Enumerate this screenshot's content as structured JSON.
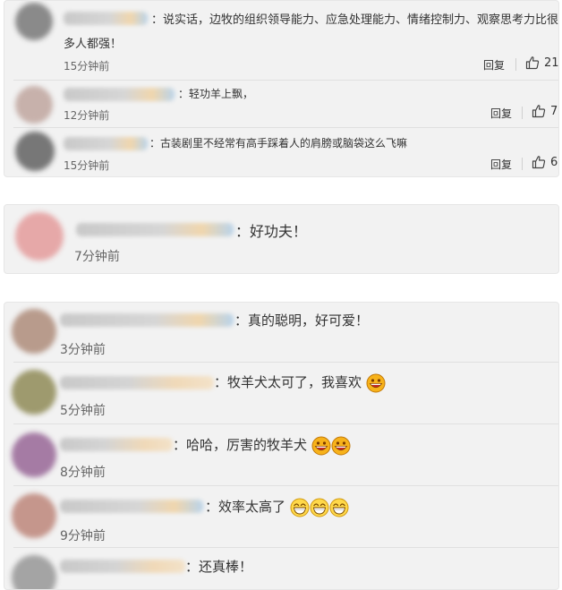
{
  "card1": {
    "comments": [
      {
        "text_line1": "：说实话，边牧的组织领导能力、应急处理能力、情绪控制力、观察思考力比很",
        "text_line2": "多人都强！",
        "time": "15分钟前",
        "reply": "回复",
        "likes": "21",
        "avatar_color": "#8a8a8a"
      },
      {
        "text": "：轻功羊上飘，",
        "time": "12分钟前",
        "reply": "回复",
        "likes": "7",
        "avatar_color": "#c7b1ab"
      },
      {
        "text": "：古装剧里不经常有高手踩着人的肩膀或脑袋这么飞嘛",
        "time": "15分钟前",
        "reply": "回复",
        "likes": "6",
        "avatar_color": "#777777"
      }
    ]
  },
  "card2": {
    "comment": {
      "text": "：好功夫！",
      "time": "7分钟前",
      "avatar_color": "#e6a8a8"
    }
  },
  "card3": {
    "comments": [
      {
        "text": "：真的聪明，好可爱！",
        "time": "3分钟前",
        "avatar_color": "#b89b8c",
        "emojis": []
      },
      {
        "text": "：牧羊犬太可了，我喜欢",
        "time": "5分钟前",
        "avatar_color": "#9e9a6e",
        "emojis": [
          "grin-emoji"
        ]
      },
      {
        "text": "：哈哈，厉害的牧羊犬",
        "time": "8分钟前",
        "avatar_color": "#a57ba4",
        "emojis": [
          "grin-emoji",
          "grin-emoji"
        ]
      },
      {
        "text": "：效率太高了",
        "time": "9分钟前",
        "avatar_color": "#c5968c",
        "emojis": [
          "laugh-emoji",
          "laugh-emoji",
          "laugh-emoji"
        ]
      },
      {
        "text": "：还真棒！",
        "time": "",
        "avatar_color": "#a4a4a4",
        "emojis": []
      }
    ]
  }
}
